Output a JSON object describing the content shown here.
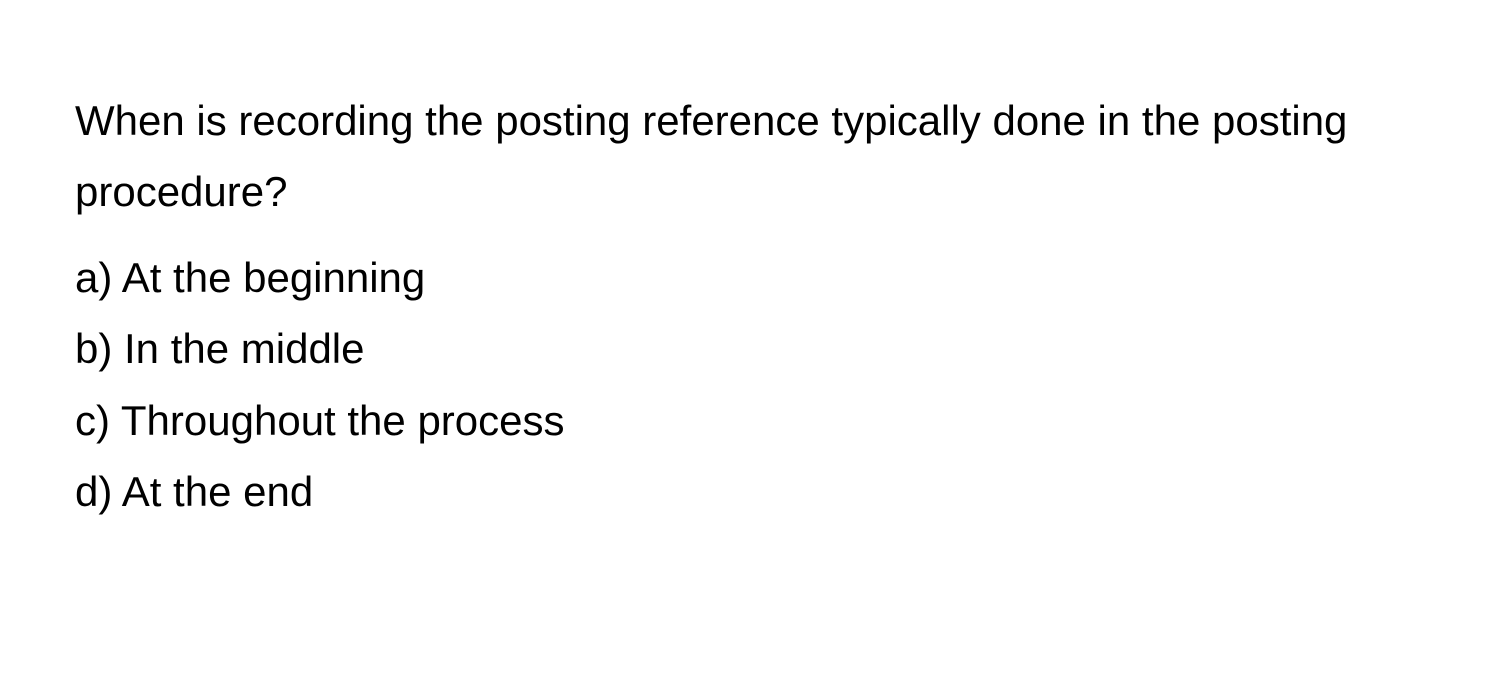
{
  "question": {
    "text": "When is recording the posting reference typically done in the posting procedure?",
    "options": [
      "a) At the beginning",
      "b) In the middle",
      "c) Throughout the process",
      "d) At the end"
    ]
  }
}
